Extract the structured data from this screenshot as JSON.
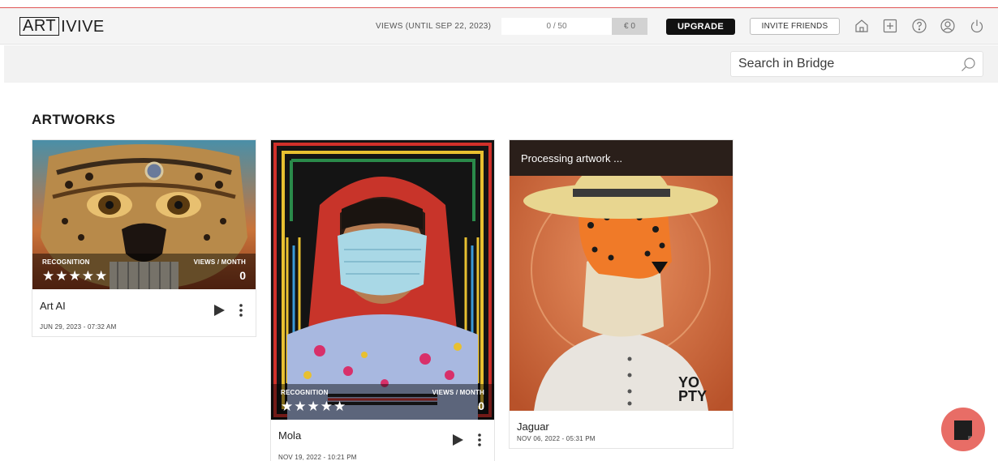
{
  "header": {
    "logo_box": "ART",
    "logo_rest": "IVIVE",
    "views_label": "VIEWS (UNTIL SEP 22, 2023)",
    "views_count": "0 / 50",
    "views_price": "€ 0",
    "upgrade_label": "UPGRADE",
    "invite_label": "INVITE FRIENDS",
    "icons": [
      "home-icon",
      "add-icon",
      "help-icon",
      "account-icon",
      "power-icon"
    ]
  },
  "search": {
    "placeholder": "Search in Bridge"
  },
  "section": {
    "title": "ARTWORKS"
  },
  "artworks": [
    {
      "title": "Art AI",
      "date": "JUN 29, 2023 - 07:32 AM",
      "recognition_label": "RECOGNITION",
      "views_label": "VIEWS / MONTH",
      "stars": "★★★★★",
      "rating": 5,
      "views": "0"
    },
    {
      "title": "Mola",
      "date": "NOV 19, 2022 - 10:21 PM",
      "recognition_label": "RECOGNITION",
      "views_label": "VIEWS / MONTH",
      "stars": "★★★★★",
      "rating": 5,
      "views": "0"
    },
    {
      "title": "Jaguar",
      "date": "NOV 06, 2022 - 05:31 PM",
      "processing_text": "Processing artwork ...",
      "badge_line1": "YO",
      "badge_line2": "PTY"
    }
  ],
  "colors": {
    "accent_line": "#e05555",
    "upgrade_bg": "#111111",
    "chat_button": "#e86d66"
  }
}
